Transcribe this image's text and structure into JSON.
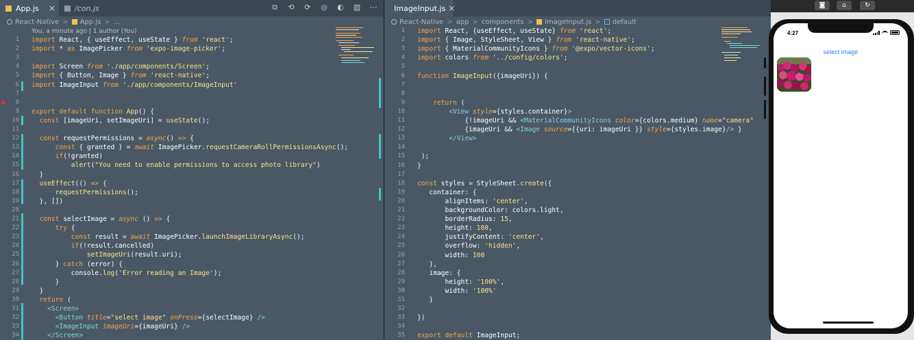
{
  "left_editor": {
    "tabs": [
      {
        "label": "App.js",
        "active": true,
        "close": "×"
      },
      {
        "label": "/con.js",
        "active": false
      }
    ],
    "breadcrumb": [
      "React-Native",
      "App.js",
      "..."
    ],
    "blame": "You, a minute ago | 1 author (You)",
    "lines": [
      "import React, { useEffect, useState } from 'react';",
      "import * as ImagePicker from 'expo-image-picker';",
      "",
      "import Screen from './app/components/Screen';",
      "import { Button, Image } from 'react-native';",
      "import ImageInput from './app/components/ImageInput'",
      "",
      "",
      "export default function App() {",
      "  const [imageUri, setImageUri] = useState();",
      "",
      "  const requestPermissions = async() => {",
      "      const { granted } = await ImagePicker.requestCameraRollPermissionsAsync();",
      "      if(!granted)",
      "          alert(\"You need to enable permissions to access photo library\")",
      "  }",
      "  useEffect(() => {",
      "      requestPermissions();",
      "  }, [])",
      "",
      "  const selectImage = async () => {",
      "      try {",
      "          const result = await ImagePicker.launchImageLibraryAsync();",
      "          if(!result.cancelled)",
      "              setImageUri(result.uri);",
      "      } catch (error) {",
      "          console.log('Error reading an Image');",
      "      }",
      "  }",
      "  return (",
      "    <Screen>",
      "      <Button title=\"select image\" onPress={selectImage} />",
      "      <ImageInput imageUri={imageUri} />",
      "    </Screen>"
    ]
  },
  "right_editor": {
    "tabs": [
      {
        "label": "ImageInput.js",
        "active": true,
        "close": "×"
      }
    ],
    "breadcrumb": [
      "React-Native",
      "app",
      "components",
      "ImageInput.js",
      "default"
    ],
    "lines": [
      "import React, {useEffect, useState} from 'react';",
      "import { Image, StyleSheet, View } from 'react-native';",
      "import { MaterialCommunityIcons } from '@expo/vector-icons';",
      "import colors from '../config/colors';",
      "",
      "function ImageInput({imageUri}) {",
      "",
      "",
      "    return (",
      "        <View style={styles.container}>",
      "            {!imageUri && <MaterialCommunityIcons color={colors.medium} name=\"camera\"",
      "            {imageUri && <Image source={{uri: imageUri }} style={styles.image}/> }",
      "        </View>",
      "",
      " );",
      "}",
      "",
      "const styles = StyleSheet.create({",
      "   container: {",
      "       alignItems: 'center',",
      "       backgroundColor: colors.light,",
      "       borderRadius: 15,",
      "       height: 100,",
      "       justifyContent: 'center',",
      "       overflow: 'hidden',",
      "       width: 100",
      "   },",
      "   image: {",
      "       height: '100%',",
      "       width: '100%'",
      "   }",
      "",
      "})",
      "",
      "export default ImageInput;"
    ]
  },
  "simulator": {
    "status_time": "4:27",
    "select_button_label": "select image",
    "toolbar_icons": [
      "screenshot-icon",
      "home-icon",
      "rotate-icon"
    ]
  },
  "colors": {
    "editor_bg": "#4a5865",
    "keyword": "#f6a54a",
    "string": "#ffe08a",
    "tag": "#7fd3d8",
    "change_bar": "#3fc7c9",
    "link_blue": "#2f7df6"
  }
}
